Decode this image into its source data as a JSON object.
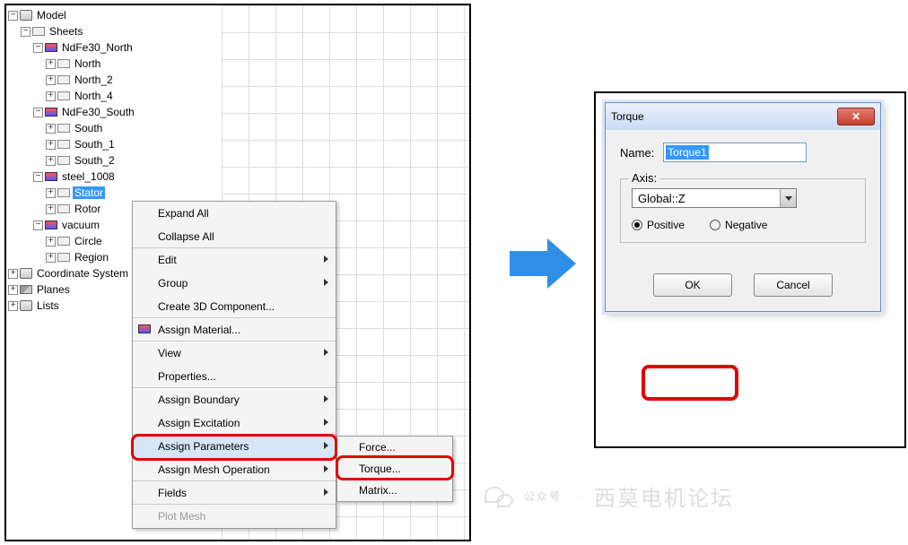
{
  "tree": {
    "root": "Model",
    "sheets": "Sheets",
    "ndfe_n": "NdFe30_North",
    "n1": "North",
    "n2": "North_2",
    "n3": "North_4",
    "ndfe_s": "NdFe30_South",
    "s1": "South",
    "s2": "South_1",
    "s3": "South_2",
    "steel": "steel_1008",
    "stator": "Stator",
    "rotor": "Rotor",
    "vacuum": "vacuum",
    "circle": "Circle",
    "region": "Region",
    "coord": "Coordinate System",
    "planes": "Planes",
    "lists": "Lists"
  },
  "ctx": {
    "expand": "Expand All",
    "collapse": "Collapse All",
    "edit": "Edit",
    "group": "Group",
    "create3d": "Create 3D Component...",
    "assign_mat": "Assign Material...",
    "view": "View",
    "props": "Properties...",
    "assign_bnd": "Assign Boundary",
    "assign_exc": "Assign Excitation",
    "assign_par": "Assign Parameters",
    "assign_mesh": "Assign Mesh Operation",
    "fields": "Fields",
    "plot_mesh": "Plot Mesh"
  },
  "sub": {
    "force": "Force...",
    "torque": "Torque...",
    "matrix": "Matrix..."
  },
  "dlg": {
    "title": "Torque",
    "name_label": "Name:",
    "name_value": "Torque1",
    "axis_label": "Axis:",
    "axis_value": "Global::Z",
    "pos": "Positive",
    "neg": "Negative",
    "ok": "OK",
    "cancel": "Cancel"
  },
  "wm": {
    "a": "公众号",
    "b": "西莫电机论坛"
  }
}
